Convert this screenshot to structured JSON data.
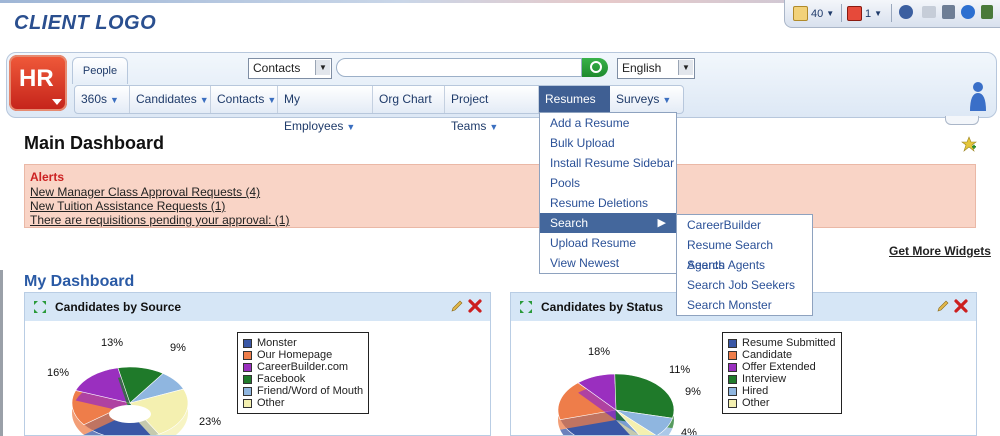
{
  "logo": "CLIENT LOGO",
  "utility": {
    "messages_count": "40",
    "alerts_count": "1"
  },
  "app_logo": "HR",
  "tab_people": "People",
  "search": {
    "scope": "Contacts",
    "value": "",
    "language": "English"
  },
  "nav": [
    "360s",
    "Candidates",
    "Contacts",
    "My Employees",
    "Org Chart",
    "Project Teams",
    "Resumes",
    "Surveys"
  ],
  "resumes_menu": [
    "Add a Resume",
    "Bulk Upload",
    "Install Resume Sidebar",
    "Pools",
    "Resume Deletions",
    "Search",
    "Upload Resume",
    "View Newest"
  ],
  "search_submenu": [
    "CareerBuilder",
    "Resume Search Agents",
    "Search Agents",
    "Search Job Seekers",
    "Search Monster"
  ],
  "main_title": "Main Dashboard",
  "alerts": {
    "title": "Alerts",
    "items": [
      "New Manager Class Approval Requests (4)",
      "New Tuition Assistance Requests (1)",
      "There are requisitions pending your approval:  (1)"
    ]
  },
  "get_more_widgets": "Get More Widgets",
  "my_dashboard": "My Dashboard",
  "colors": {
    "blue": "#3a57a6",
    "orange": "#ee7d4a",
    "purple": "#9a2fbf",
    "green": "#1f7a2a",
    "lightblue": "#8fb6e0",
    "cream": "#f4f0b0"
  },
  "chart_data": [
    {
      "type": "pie",
      "title": "Candidates by Source",
      "categories": [
        "Monster",
        "Our Homepage",
        "CareerBuilder.com",
        "Facebook",
        "Friend/Word of Mouth",
        "Other"
      ],
      "values": [
        null,
        16,
        16,
        13,
        9,
        23
      ],
      "visible_labels": [
        "13%",
        "9%",
        "16%",
        "23%",
        "16%"
      ]
    },
    {
      "type": "pie",
      "title": "Candidates by Status",
      "categories": [
        "Resume Submitted",
        "Candidate",
        "Offer Extended",
        "Interview",
        "Hired",
        "Other"
      ],
      "values": [
        null,
        18,
        11,
        null,
        9,
        4
      ],
      "visible_labels": [
        "18%",
        "11%",
        "9%",
        "4%"
      ]
    }
  ]
}
